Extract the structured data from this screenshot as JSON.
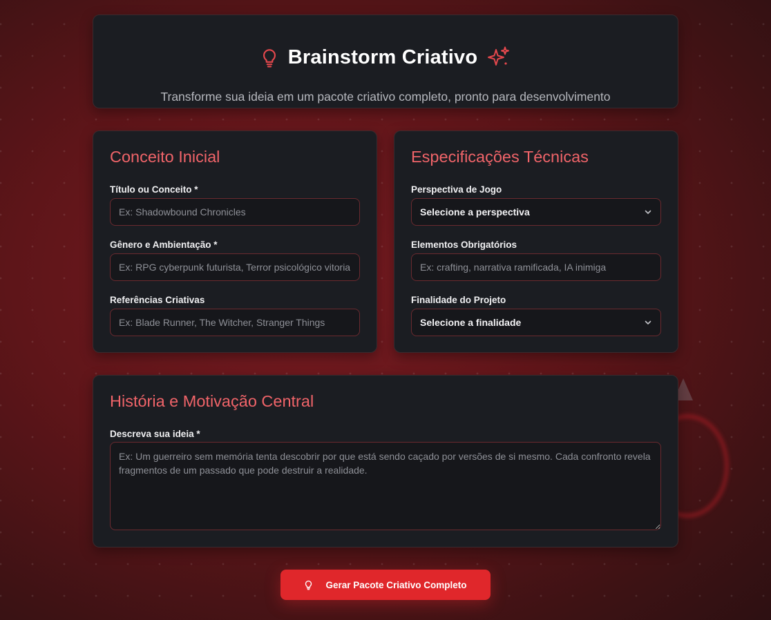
{
  "header": {
    "title": "Brainstorm Criativo",
    "subtitle": "Transforme sua ideia em um pacote criativo completo, pronto para desenvolvimento",
    "icons": [
      "lightbulb-icon",
      "sparkles-icon"
    ]
  },
  "concept": {
    "title": "Conceito Inicial",
    "fields": {
      "title": {
        "label": "Título ou Conceito *",
        "placeholder": "Ex: Shadowbound Chronicles"
      },
      "genre": {
        "label": "Gênero e Ambientação *",
        "placeholder": "Ex: RPG cyberpunk futurista, Terror psicológico vitoriano"
      },
      "references": {
        "label": "Referências Criativas",
        "placeholder": "Ex: Blade Runner, The Witcher, Stranger Things"
      }
    }
  },
  "specs": {
    "title": "Especificações Técnicas",
    "fields": {
      "perspective": {
        "label": "Perspectiva de Jogo",
        "value": "Selecione a perspectiva"
      },
      "elements": {
        "label": "Elementos Obrigatórios",
        "placeholder": "Ex: crafting, narrativa ramificada, IA inimiga"
      },
      "purpose": {
        "label": "Finalidade do Projeto",
        "value": "Selecione a finalidade"
      }
    }
  },
  "story": {
    "title": "História e Motivação Central",
    "label": "Descreva sua ideia *",
    "placeholder": "Ex: Um guerreiro sem memória tenta descobrir por que está sendo caçado por versões de si mesmo. Cada confronto revela fragmentos de um passado que pode destruir a realidade."
  },
  "cta": {
    "label": "Gerar Pacote Criativo Completo",
    "icon": "lightbulb-icon"
  },
  "colors": {
    "accent": "#f06469",
    "button": "#e0272b",
    "card": "#1b1d22"
  }
}
